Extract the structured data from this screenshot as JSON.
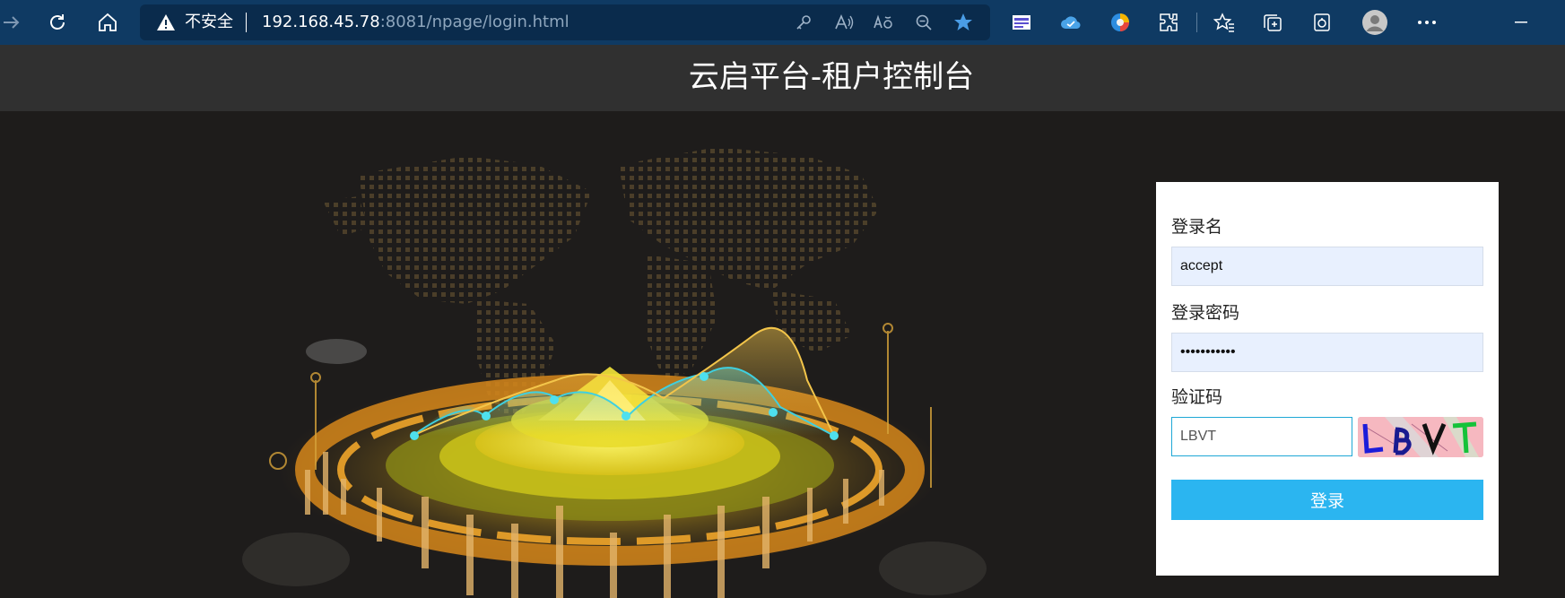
{
  "browser": {
    "security_label": "不安全",
    "url_host": "192.168.45.78",
    "url_rest": ":8081/npage/login.html"
  },
  "page": {
    "title": "云启平台-租户控制台"
  },
  "login_form": {
    "username_label": "登录名",
    "username_value": "accept",
    "password_label": "登录密码",
    "password_value": "•••••••••••",
    "captcha_label": "验证码",
    "captcha_value": "LBVT",
    "captcha_image_text": "LBVT",
    "submit_label": "登录"
  },
  "colors": {
    "chrome_bg": "#0f3a63",
    "header_bg": "#303030",
    "button_bg": "#2bb5f0",
    "input_bg": "#e8f0fe"
  }
}
